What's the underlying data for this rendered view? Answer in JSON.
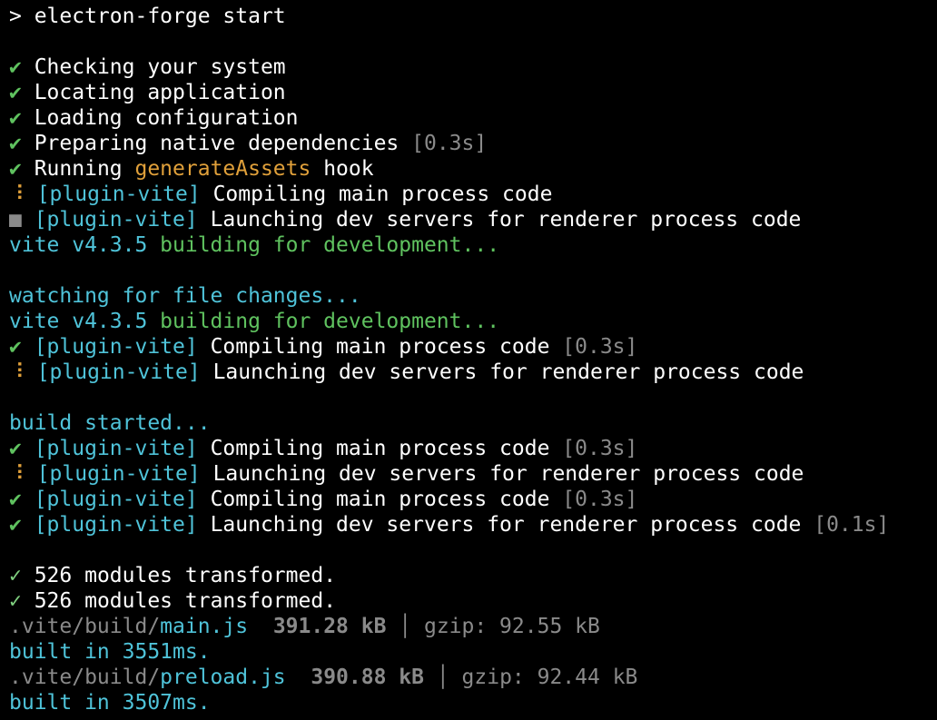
{
  "terminal": {
    "lines": [
      [
        {
          "t": "> electron-forge start",
          "c": "white"
        }
      ],
      [],
      [
        {
          "t": "✔ ",
          "c": "green"
        },
        {
          "t": "Checking your system",
          "c": "white"
        }
      ],
      [
        {
          "t": "✔ ",
          "c": "green"
        },
        {
          "t": "Locating application",
          "c": "white"
        }
      ],
      [
        {
          "t": "✔ ",
          "c": "green"
        },
        {
          "t": "Loading configuration",
          "c": "white"
        }
      ],
      [
        {
          "t": "✔ ",
          "c": "green"
        },
        {
          "t": "Preparing native dependencies ",
          "c": "white"
        },
        {
          "t": "[0.3s]",
          "c": "gray"
        }
      ],
      [
        {
          "t": "✔ ",
          "c": "green"
        },
        {
          "t": "Running ",
          "c": "white"
        },
        {
          "t": "generateAssets",
          "c": "orange"
        },
        {
          "t": " hook",
          "c": "white"
        }
      ],
      [
        {
          "t": "⠸ ",
          "c": "orange"
        },
        {
          "t": "[plugin-vite]",
          "c": "cyan"
        },
        {
          "t": " Compiling main process code",
          "c": "white"
        }
      ],
      [
        {
          "t": "■ ",
          "c": "gray"
        },
        {
          "t": "[plugin-vite]",
          "c": "cyan"
        },
        {
          "t": " Launching dev servers for renderer process code",
          "c": "white"
        }
      ],
      [
        {
          "t": "vite v4.3.5 ",
          "c": "cyan"
        },
        {
          "t": "building for development...",
          "c": "green"
        }
      ],
      [],
      [
        {
          "t": "watching for file changes...",
          "c": "cyan"
        }
      ],
      [
        {
          "t": "vite v4.3.5 ",
          "c": "cyan"
        },
        {
          "t": "building for development...",
          "c": "green"
        }
      ],
      [
        {
          "t": "✔ ",
          "c": "green"
        },
        {
          "t": "[plugin-vite]",
          "c": "cyan"
        },
        {
          "t": " Compiling main process code ",
          "c": "white"
        },
        {
          "t": "[0.3s]",
          "c": "gray"
        }
      ],
      [
        {
          "t": "⠸ ",
          "c": "orange"
        },
        {
          "t": "[plugin-vite]",
          "c": "cyan"
        },
        {
          "t": " Launching dev servers for renderer process code",
          "c": "white"
        }
      ],
      [],
      [
        {
          "t": "build started...",
          "c": "cyan"
        }
      ],
      [
        {
          "t": "✔ ",
          "c": "green"
        },
        {
          "t": "[plugin-vite]",
          "c": "cyan"
        },
        {
          "t": " Compiling main process code ",
          "c": "white"
        },
        {
          "t": "[0.3s]",
          "c": "gray"
        }
      ],
      [
        {
          "t": "⠸ ",
          "c": "orange"
        },
        {
          "t": "[plugin-vite]",
          "c": "cyan"
        },
        {
          "t": " Launching dev servers for renderer process code",
          "c": "white"
        }
      ],
      [
        {
          "t": "✔ ",
          "c": "green"
        },
        {
          "t": "[plugin-vite]",
          "c": "cyan"
        },
        {
          "t": " Compiling main process code ",
          "c": "white"
        },
        {
          "t": "[0.3s]",
          "c": "gray"
        }
      ],
      [
        {
          "t": "✔ ",
          "c": "green"
        },
        {
          "t": "[plugin-vite]",
          "c": "cyan"
        },
        {
          "t": " Launching dev servers for renderer process code ",
          "c": "white"
        },
        {
          "t": "[0.1s]",
          "c": "gray"
        }
      ],
      [],
      [
        {
          "t": "✓ ",
          "c": "lightgreen"
        },
        {
          "t": "526 modules transformed.",
          "c": "white"
        }
      ],
      [
        {
          "t": "✓ ",
          "c": "lightgreen"
        },
        {
          "t": "526 modules transformed.",
          "c": "white"
        }
      ],
      [
        {
          "t": ".vite/build/",
          "c": "gray"
        },
        {
          "t": "main.js",
          "c": "cyan"
        },
        {
          "t": "  ",
          "c": "white"
        },
        {
          "t": "391.28 kB",
          "c": "gray",
          "b": true
        },
        {
          "t": " │ gzip: 92.55 kB",
          "c": "gray"
        }
      ],
      [
        {
          "t": "built in 3551ms.",
          "c": "cyan"
        }
      ],
      [
        {
          "t": ".vite/build/",
          "c": "gray"
        },
        {
          "t": "preload.js",
          "c": "cyan"
        },
        {
          "t": "  ",
          "c": "white"
        },
        {
          "t": "390.88 kB",
          "c": "gray",
          "b": true
        },
        {
          "t": " │ gzip: 92.44 kB",
          "c": "gray"
        }
      ],
      [
        {
          "t": "built in 3507ms.",
          "c": "cyan"
        }
      ]
    ]
  },
  "colors": {
    "background": "#000000",
    "text": "#ffffff",
    "green": "#5fc25f",
    "cyan": "#4fc3d9",
    "orange": "#e0a03a",
    "gray": "#8a8a8a"
  }
}
